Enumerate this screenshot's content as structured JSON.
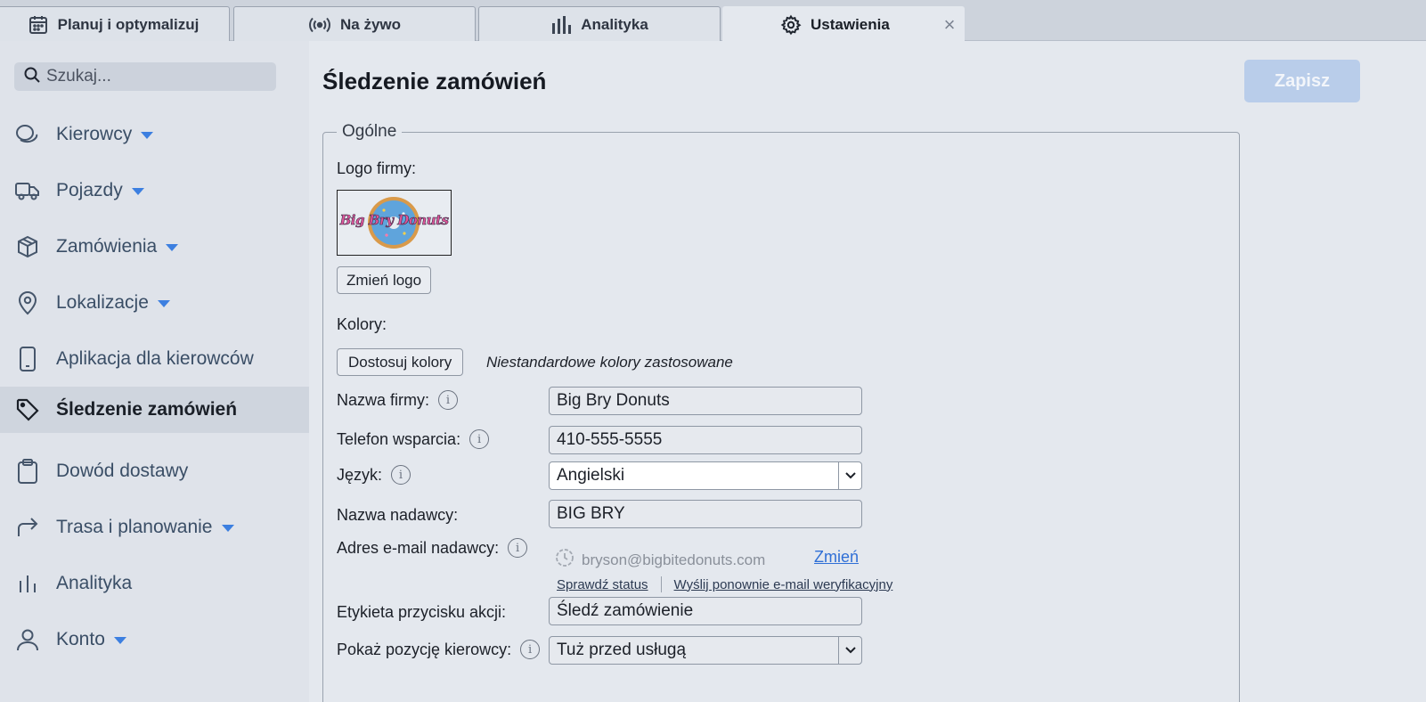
{
  "tabs": [
    {
      "label": "Planuj i optymalizuj",
      "icon": "calendar-icon"
    },
    {
      "label": "Na żywo",
      "icon": "broadcast-icon"
    },
    {
      "label": "Analityka",
      "icon": "bar-chart-icon"
    },
    {
      "label": "Ustawienia",
      "icon": "gear-icon",
      "active": true
    }
  ],
  "search": {
    "placeholder": "Szukaj..."
  },
  "sidebar": {
    "items": [
      {
        "label": "Kierowcy",
        "icon": "driver-icon",
        "expandable": true
      },
      {
        "label": "Pojazdy",
        "icon": "truck-icon",
        "expandable": true
      },
      {
        "label": "Zamówienia",
        "icon": "box-icon",
        "expandable": true
      },
      {
        "label": "Lokalizacje",
        "icon": "location-pin-icon",
        "expandable": true
      },
      {
        "label": "Aplikacja dla kierowców",
        "icon": "phone-icon",
        "expandable": false
      },
      {
        "label": "Śledzenie zamówień",
        "icon": "tag-icon",
        "expandable": false,
        "active": true
      },
      {
        "label": "Dowód dostawy",
        "icon": "clipboard-icon",
        "expandable": false
      },
      {
        "label": "Trasa i planowanie",
        "icon": "route-arrow-icon",
        "expandable": true
      },
      {
        "label": "Analityka",
        "icon": "bar-chart-icon",
        "expandable": false
      },
      {
        "label": "Konto",
        "icon": "user-icon",
        "expandable": true
      }
    ]
  },
  "main": {
    "title": "Śledzenie zamówień",
    "save_label": "Zapisz",
    "section_legend": "Ogólne",
    "logo_label": "Logo firmy:",
    "logo_text": "Big Bry Donuts",
    "change_logo_label": "Zmień logo",
    "colors_label": "Kolory:",
    "customize_colors_label": "Dostosuj kolory",
    "custom_colors_note": "Niestandardowe kolory zastosowane",
    "company_name": {
      "label": "Nazwa firmy:",
      "value": "Big Bry Donuts"
    },
    "support_phone": {
      "label": "Telefon wsparcia:",
      "value": "410-555-5555"
    },
    "language": {
      "label": "Język:",
      "value": "Angielski"
    },
    "sender_name": {
      "label": "Nazwa nadawcy:",
      "value": "BIG BRY"
    },
    "sender_email": {
      "label": "Adres e-mail nadawcy:",
      "value": "bryson@bigbitedonuts.com",
      "change_label": "Zmień",
      "check_status_label": "Sprawdź status",
      "resend_label": "Wyślij ponownie e-mail weryfikacyjny"
    },
    "action_button_label": {
      "label": "Etykieta przycisku akcji:",
      "value": "Śledź zamówienie"
    },
    "driver_position": {
      "label": "Pokaż pozycję kierowcy:",
      "value": "Tuż przed usługą"
    }
  },
  "colors": {
    "accent": "#3c7fe0",
    "save_disabled": "#b9cdea",
    "link": "#2f6fd6"
  }
}
